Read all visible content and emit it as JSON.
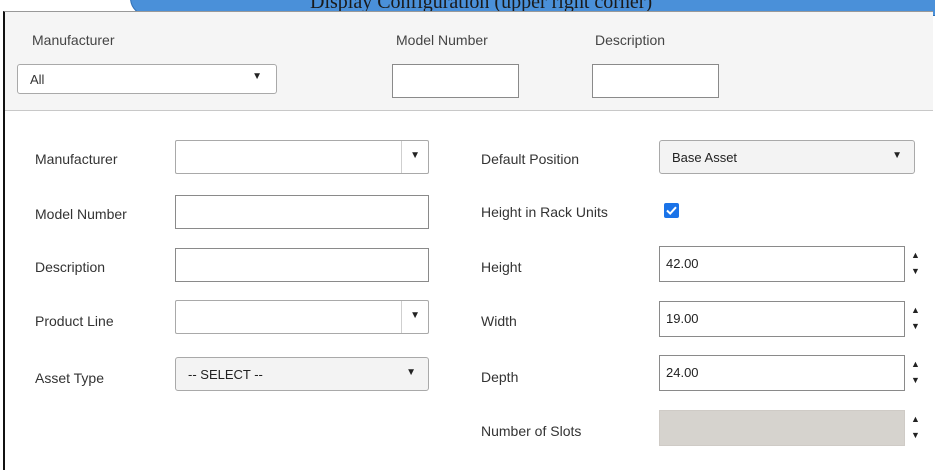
{
  "banner": {
    "text": "Display Configuration (upper right corner)"
  },
  "filter_bar": {
    "manufacturer_label": "Manufacturer",
    "model_number_label": "Model Number",
    "description_label": "Description",
    "manufacturer_value": "All",
    "model_number_value": "",
    "description_value": ""
  },
  "form": {
    "left": {
      "manufacturer_label": "Manufacturer",
      "manufacturer_value": "",
      "model_number_label": "Model Number",
      "model_number_value": "",
      "description_label": "Description",
      "description_value": "",
      "product_line_label": "Product Line",
      "product_line_value": "",
      "asset_type_label": "Asset Type",
      "asset_type_value": "-- SELECT --"
    },
    "right": {
      "default_position_label": "Default Position",
      "default_position_value": "Base Asset",
      "height_in_rack_units_label": "Height in Rack Units",
      "height_in_rack_units_checked": true,
      "height_label": "Height",
      "height_value": "42.00",
      "width_label": "Width",
      "width_value": "19.00",
      "depth_label": "Depth",
      "depth_value": "24.00",
      "number_of_slots_label": "Number of Slots",
      "number_of_slots_value": ""
    }
  },
  "colors": {
    "checkbox_accent": "#1a73e8",
    "disabled_field": "#d6d3ce"
  }
}
